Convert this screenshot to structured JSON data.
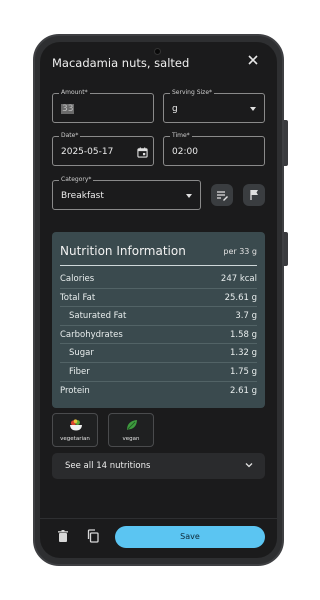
{
  "dialog": {
    "title": "Macadamia nuts, salted",
    "close_icon": "close-icon"
  },
  "form": {
    "amount": {
      "label": "Amount*",
      "value": "33"
    },
    "serving_size": {
      "label": "Serving Size*",
      "value": "g"
    },
    "date": {
      "label": "Date*",
      "value": "2025-05-17"
    },
    "time": {
      "label": "Time*",
      "value": "02:00"
    },
    "category": {
      "label": "Category*",
      "value": "Breakfast"
    }
  },
  "actions": {
    "notes_icon": "edit-note-icon",
    "flag_icon": "flag-icon"
  },
  "nutrition": {
    "heading": "Nutrition Information",
    "per": "per 33 g",
    "rows": [
      {
        "label": "Calories",
        "value": "247 kcal"
      },
      {
        "label": "Total Fat",
        "value": "25.61 g"
      },
      {
        "label": "Saturated Fat",
        "value": "3.7 g"
      },
      {
        "label": "Carbohydrates",
        "value": "1.58 g"
      },
      {
        "label": "Sugar",
        "value": "1.32 g"
      },
      {
        "label": "Fiber",
        "value": "1.75 g"
      },
      {
        "label": "Protein",
        "value": "2.61 g"
      }
    ]
  },
  "tags": [
    {
      "label": "vegetarian",
      "icon": "salad-bowl-icon"
    },
    {
      "label": "vegan",
      "icon": "leaf-icon"
    }
  ],
  "see_all": {
    "label": "See all 14 nutritions"
  },
  "toolbar": {
    "delete_icon": "trash-icon",
    "copy_icon": "copy-icon",
    "save_label": "Save"
  },
  "colors": {
    "accent": "#5bc5f2",
    "panel": "#3a4a4e",
    "background": "#1b1b1c"
  }
}
